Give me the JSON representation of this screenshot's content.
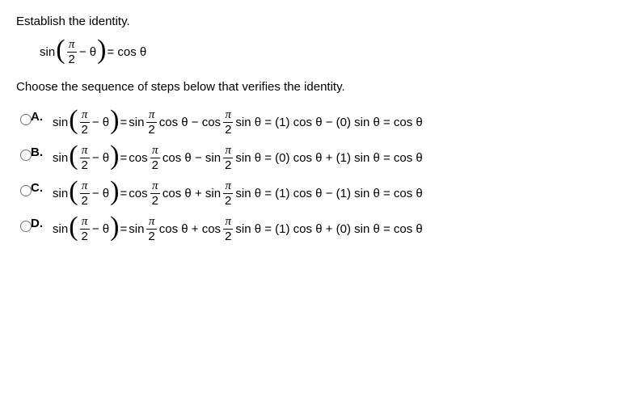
{
  "prompt": "Establish the identity.",
  "identity": {
    "fn": "sin",
    "paren_left": "(",
    "frac_num": "π",
    "frac_den": "2",
    "minus_theta": " − θ",
    "paren_right": ")",
    "equals_rhs": " = cos θ"
  },
  "instruction": "Choose the sequence of steps below that verifies the identity.",
  "choices": [
    {
      "letter": "A.",
      "lead_fn": "sin",
      "paren_left": "(",
      "frac_num": "π",
      "frac_den": "2",
      "minus_theta": " − θ",
      "paren_right": ")",
      "eq": " = ",
      "t1_fn": "sin ",
      "t1_num": "π",
      "t1_den": "2",
      "t1_tail": " cos θ − cos ",
      "t2_num": "π",
      "t2_den": "2",
      "t2_tail": " sin θ = (1) cos θ − (0) sin θ = cos θ"
    },
    {
      "letter": "B.",
      "lead_fn": "sin",
      "paren_left": "(",
      "frac_num": "π",
      "frac_den": "2",
      "minus_theta": " − θ",
      "paren_right": ")",
      "eq": " = ",
      "t1_fn": "cos ",
      "t1_num": "π",
      "t1_den": "2",
      "t1_tail": " cos θ − sin ",
      "t2_num": "π",
      "t2_den": "2",
      "t2_tail": " sin θ = (0) cos θ + (1) sin θ = cos θ"
    },
    {
      "letter": "C.",
      "lead_fn": "sin",
      "paren_left": "(",
      "frac_num": "π",
      "frac_den": "2",
      "minus_theta": " − θ",
      "paren_right": ")",
      "eq": " = ",
      "t1_fn": "cos ",
      "t1_num": "π",
      "t1_den": "2",
      "t1_tail": " cos θ + sin ",
      "t2_num": "π",
      "t2_den": "2",
      "t2_tail": " sin θ = (1) cos θ − (1) sin θ = cos θ"
    },
    {
      "letter": "D.",
      "lead_fn": "sin",
      "paren_left": "(",
      "frac_num": "π",
      "frac_den": "2",
      "minus_theta": " − θ",
      "paren_right": ")",
      "eq": " = ",
      "t1_fn": "sin ",
      "t1_num": "π",
      "t1_den": "2",
      "t1_tail": " cos θ + cos ",
      "t2_num": "π",
      "t2_den": "2",
      "t2_tail": " sin θ = (1) cos θ + (0) sin θ = cos θ"
    }
  ]
}
